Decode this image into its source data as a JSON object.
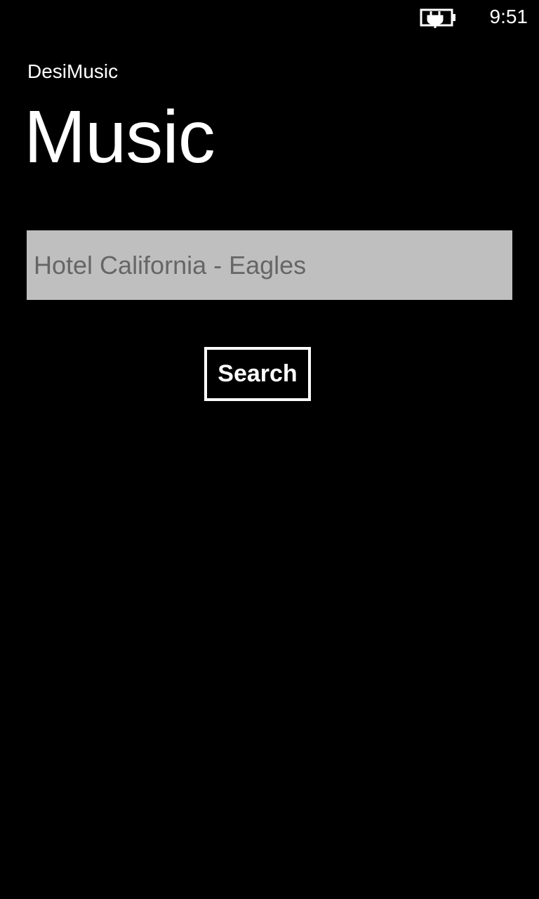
{
  "status_bar": {
    "time": "9:51",
    "battery_icon": "battery-charging-icon"
  },
  "header": {
    "app_name": "DesiMusic",
    "page_title": "Music"
  },
  "search": {
    "placeholder": "Hotel California - Eagles",
    "value": "",
    "button_label": "Search"
  },
  "colors": {
    "background": "#000000",
    "foreground": "#ffffff",
    "input_background": "#bfbfbf",
    "input_text": "#666666"
  }
}
